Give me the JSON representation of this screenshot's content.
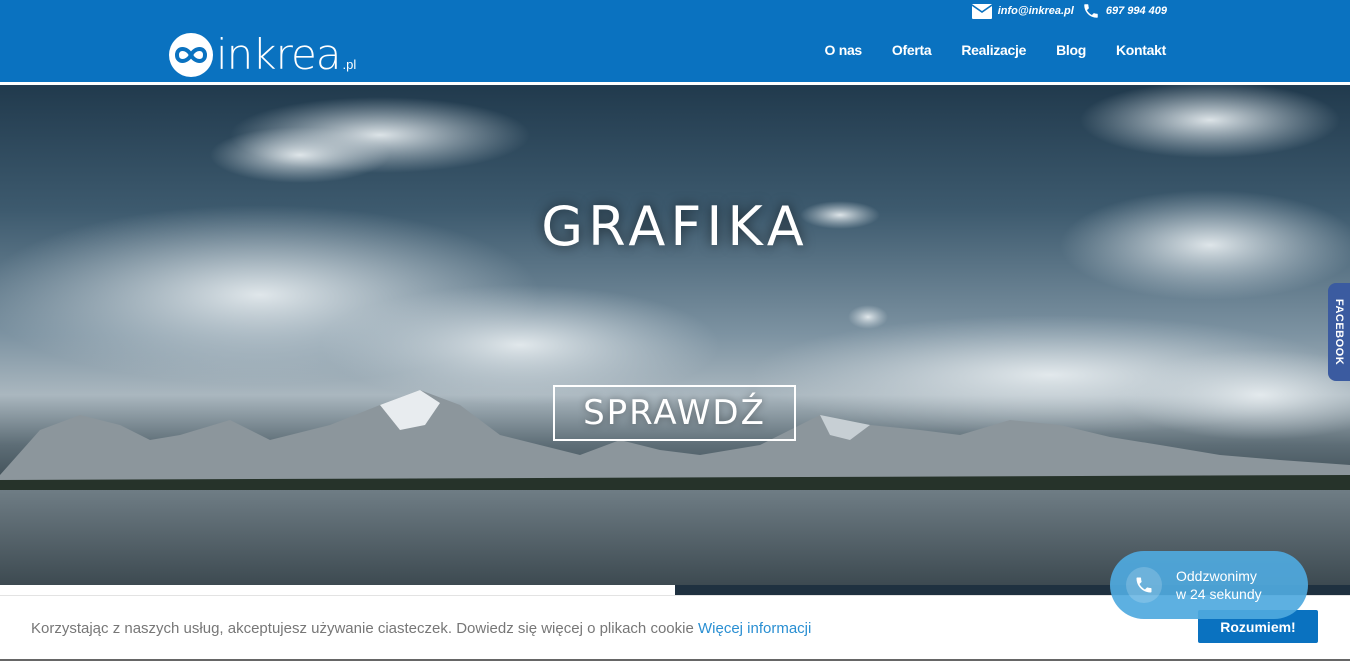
{
  "brand": {
    "name": "inkrea",
    "tld": ".pl"
  },
  "contact": {
    "email": "info@inkrea.pl",
    "phone": "697 994 409"
  },
  "nav": {
    "items": [
      {
        "label": "O nas"
      },
      {
        "label": "Oferta"
      },
      {
        "label": "Realizacje"
      },
      {
        "label": "Blog"
      },
      {
        "label": "Kontakt"
      }
    ]
  },
  "hero": {
    "title": "GRAFIKA",
    "button_label": "SPRAWDŹ"
  },
  "slider": {
    "progress": 0.5
  },
  "facebook_tab": {
    "label": "FACEBOOK"
  },
  "callback": {
    "line1": "Oddzwonimy",
    "line2": "w 24 sekundy"
  },
  "cookie": {
    "message": "Korzystając z naszych usług, akceptujesz używanie ciasteczek. Dowiedz się więcej o plikach cookie",
    "link_label": "Więcej informacji",
    "accept_label": "Rozumiem!"
  },
  "colors": {
    "brand_blue": "#0a72c0",
    "facebook": "#3b5ba0",
    "callback": "#4fa9de",
    "link": "#2a8fd2"
  }
}
